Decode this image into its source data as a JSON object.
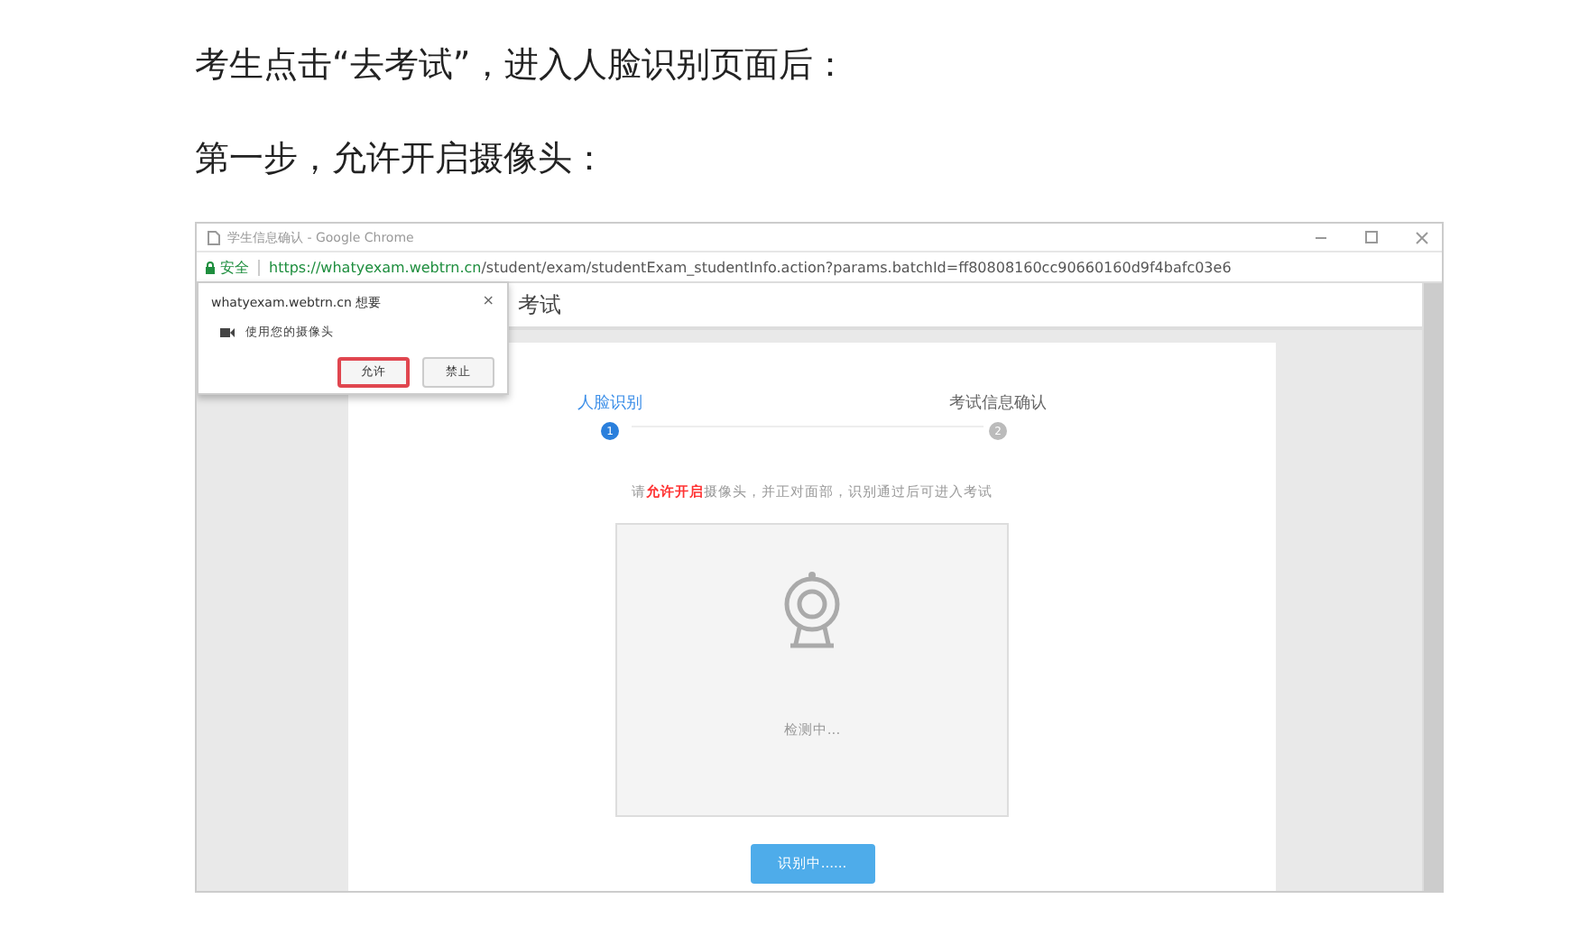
{
  "paragraphs": [
    "考生点击“去考试”，进入人脸识别页面后：",
    "第一步，允许开启摄像头："
  ],
  "browser": {
    "title": "学生信息确认 - Google Chrome",
    "security": "安全",
    "url_host": "https://whatyexam.webtrn.cn",
    "url_path": "/student/exam/studentExam_studentInfo.action?params.batchId=ff80808160cc90660160d9f4bafc03e6",
    "header_title": "考试",
    "steps": [
      {
        "label": "人脸识别",
        "number": "1",
        "selected": true
      },
      {
        "label": "考试信息确认",
        "number": "2",
        "selected": false
      }
    ],
    "instruction": "请**允许开启**摄像头，并正对面部，识别通过后可进入考试",
    "camera_status": "检测中...",
    "button": "识别中......",
    "permission_popup": {
      "site": "whatyexam.webtrn.cn 想要",
      "close": "×",
      "request": "使用您的摄像头",
      "buttons": [
        {
          "label": "允许",
          "selected": true
        },
        {
          "label": "禁止",
          "selected": false
        }
      ]
    }
  }
}
